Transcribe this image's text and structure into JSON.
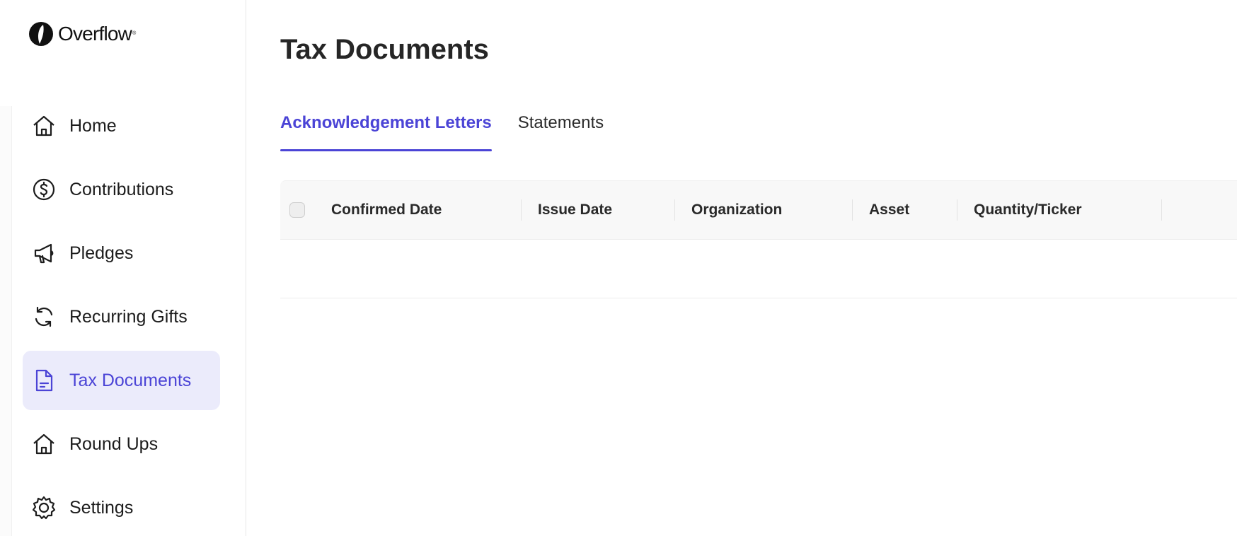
{
  "app": {
    "logo_text": "Overflow",
    "logo_mark_sup": "®"
  },
  "sidebar": {
    "items": [
      {
        "label": "Home",
        "icon": "home-icon",
        "active": false
      },
      {
        "label": "Contributions",
        "icon": "dollar-circle-icon",
        "active": false
      },
      {
        "label": "Pledges",
        "icon": "megaphone-icon",
        "active": false
      },
      {
        "label": "Recurring Gifts",
        "icon": "refresh-icon",
        "active": false
      },
      {
        "label": "Tax Documents",
        "icon": "document-icon",
        "active": true
      },
      {
        "label": "Round Ups",
        "icon": "home-icon",
        "active": false
      },
      {
        "label": "Settings",
        "icon": "gear-icon",
        "active": false
      }
    ]
  },
  "main": {
    "title": "Tax Documents",
    "tabs": [
      {
        "label": "Acknowledgement Letters",
        "active": true
      },
      {
        "label": "Statements",
        "active": false
      }
    ],
    "table": {
      "columns": [
        "Confirmed Date",
        "Issue Date",
        "Organization",
        "Asset",
        "Quantity/Ticker"
      ],
      "rows": []
    }
  },
  "colors": {
    "accent": "#4b44d6",
    "active_bg": "#ebebfb",
    "text": "#1c1c1c",
    "header_bg": "#f8f8f8"
  }
}
